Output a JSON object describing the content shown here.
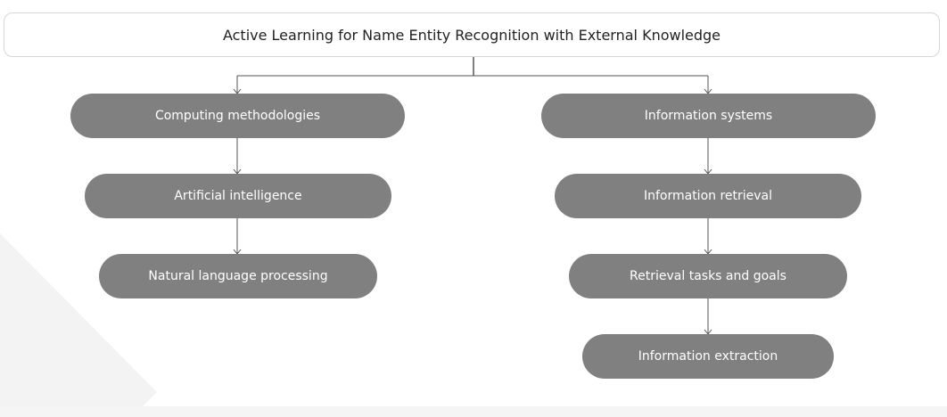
{
  "diagram": {
    "root": {
      "label": "Active Learning for Name Entity Recognition with External Knowledge"
    },
    "left_branch": [
      "Computing methodologies",
      "Artificial intelligence",
      "Natural language processing"
    ],
    "right_branch": [
      "Information systems",
      "Information retrieval",
      "Retrieval tasks and goals",
      "Information extraction"
    ]
  },
  "colors": {
    "node_fill": "#808080",
    "node_text": "#ffffff",
    "root_border": "#d6d6d6",
    "connector": "#555555"
  }
}
